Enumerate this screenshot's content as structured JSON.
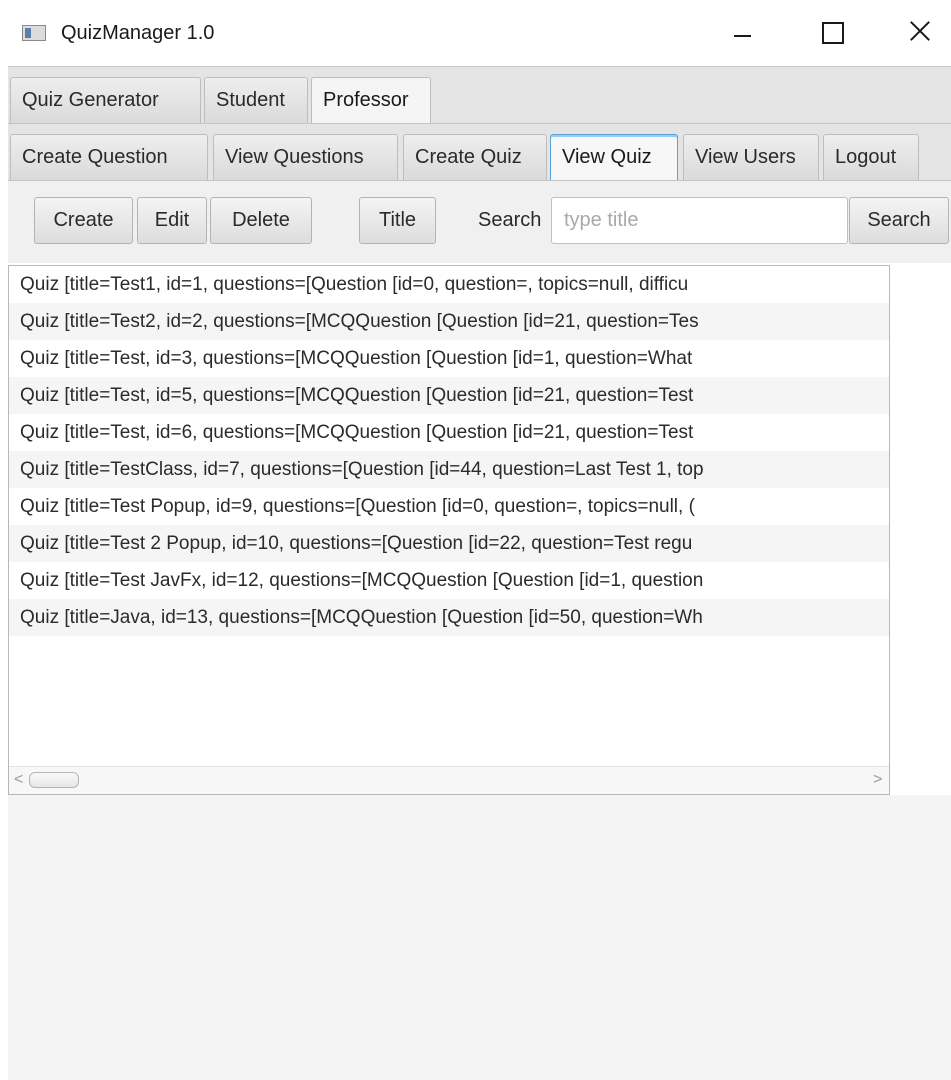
{
  "window": {
    "title": "QuizManager 1.0",
    "minimize_icon": "minimize-icon",
    "maximize_icon": "maximize-icon",
    "close_icon": "close-icon"
  },
  "main_tabs": [
    {
      "label": "Quiz Generator"
    },
    {
      "label": "Student"
    },
    {
      "label": "Professor",
      "selected": true
    }
  ],
  "sub_tabs": [
    {
      "label": "Create Question"
    },
    {
      "label": "View Questions"
    },
    {
      "label": "Create Quiz"
    },
    {
      "label": "View Quiz",
      "selected": true
    },
    {
      "label": "View Users"
    },
    {
      "label": "Logout"
    }
  ],
  "toolbar": {
    "create_label": "Create",
    "edit_label": "Edit",
    "delete_label": "Delete",
    "title_label": "Title",
    "search_label": "Search",
    "search_placeholder": "type title",
    "search_value": "",
    "search_button_label": "Search"
  },
  "quiz_list": [
    "Quiz [title=Test1, id=1, questions=[Question [id=0, question=, topics=null, difficu",
    "Quiz [title=Test2, id=2, questions=[MCQQuestion [Question [id=21, question=Tes",
    "Quiz [title=Test, id=3, questions=[MCQQuestion [Question [id=1, question=What",
    "Quiz [title=Test, id=5, questions=[MCQQuestion [Question [id=21, question=Test",
    "Quiz [title=Test, id=6, questions=[MCQQuestion [Question [id=21, question=Test",
    "Quiz [title=TestClass, id=7, questions=[Question [id=44, question=Last Test 1, top",
    "Quiz [title=Test Popup, id=9, questions=[Question [id=0, question=, topics=null, (",
    "Quiz [title=Test 2 Popup, id=10, questions=[Question [id=22, question=Test regu",
    "Quiz [title=Test JavFx, id=12, questions=[MCQQuestion [Question [id=1, question",
    "Quiz [title=Java, id=13, questions=[MCQQuestion [Question [id=50, question=Wh"
  ],
  "scrollbar": {
    "left_arrow": "<",
    "right_arrow": ">"
  }
}
